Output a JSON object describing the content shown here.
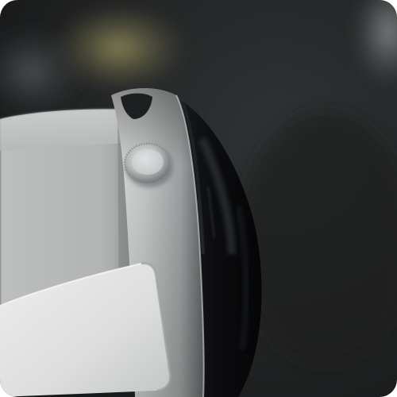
{
  "palette": {
    "background_dark": "#1c1d1e",
    "background_mid": "#2c2f30",
    "bokeh_warm": "#8a8458",
    "fabric": "#b9bbbc",
    "aluminum": "#c8cacb",
    "glass": "#0b0c0e",
    "crown": "#b7b9ba",
    "pad": "#e1e2e2"
  },
  "objects": [
    "blurred-background",
    "mesh-fabric",
    "aluminum-frame",
    "digital-crown",
    "black-glass-dome",
    "light-pad"
  ]
}
